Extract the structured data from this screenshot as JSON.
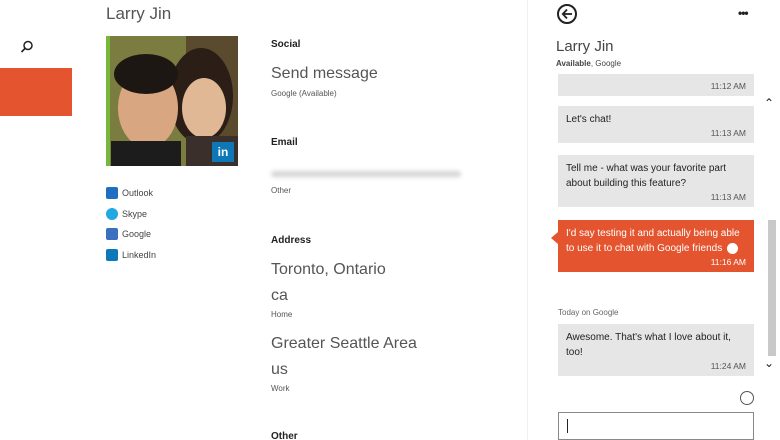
{
  "contact": {
    "name": "Larry Jin",
    "accounts": [
      {
        "label": "Outlook",
        "icon": "outlook-icon",
        "color": "#1e6fc1"
      },
      {
        "label": "Skype",
        "icon": "skype-icon",
        "color": "#21a9e1"
      },
      {
        "label": "Google",
        "icon": "google-icon",
        "color": "#3b6fbf"
      },
      {
        "label": "LinkedIn",
        "icon": "linkedin-icon",
        "color": "#0d77b7"
      }
    ],
    "photo_badge": "in"
  },
  "details": {
    "social_title": "Social",
    "send_message": "Send message",
    "send_message_sub": "Google (Available)",
    "email_title": "Email",
    "email_sub": "Other",
    "address_title": "Address",
    "address1_line1": "Toronto, Ontario",
    "address1_line2": "ca",
    "address1_sub": "Home",
    "address2_line1": "Greater Seattle Area",
    "address2_line2": "us",
    "address2_sub": "Work",
    "other_title": "Other"
  },
  "chat": {
    "name": "Larry Jin",
    "status_bold": "Available",
    "status_rest": ", Google",
    "messages": [
      {
        "text": "",
        "time": "11:12 AM",
        "sent": false
      },
      {
        "text": "Let's chat!",
        "time": "11:13 AM",
        "sent": false
      },
      {
        "text": "Tell me - what was your favorite part about building this feature?",
        "time": "11:13 AM",
        "sent": false
      },
      {
        "text": "I'd say testing it and actually being able to use it to chat with Google friends",
        "time": "11:16 AM",
        "sent": true
      },
      {
        "text": "Awesome. That's what I love about it, too!",
        "time": "11:24 AM",
        "sent": false
      }
    ],
    "day_label": "Today on Google"
  },
  "colors": {
    "accent": "#e4552f",
    "bubble": "#e6e6e6"
  }
}
